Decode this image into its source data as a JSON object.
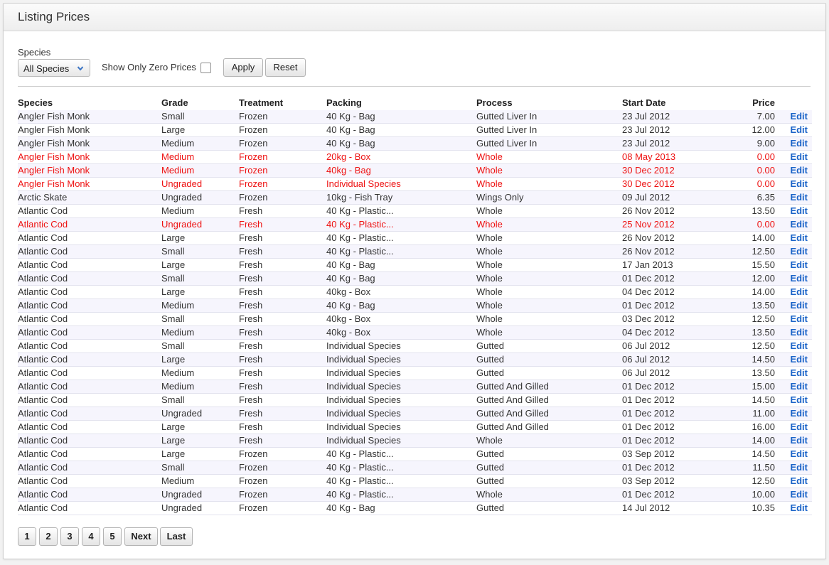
{
  "title": "Listing Prices",
  "filters": {
    "species_label": "Species",
    "species_selected": "All Species",
    "zero_label": "Show Only Zero Prices",
    "apply_label": "Apply",
    "reset_label": "Reset"
  },
  "table": {
    "headers": {
      "species": "Species",
      "grade": "Grade",
      "treatment": "Treatment",
      "packing": "Packing",
      "process": "Process",
      "start_date": "Start Date",
      "price": "Price"
    },
    "edit_label": "Edit",
    "rows": [
      {
        "species": "Angler Fish Monk",
        "grade": "Small",
        "treatment": "Frozen",
        "packing": "40 Kg - Bag",
        "process": "Gutted Liver In",
        "start_date": "23 Jul 2012",
        "price": "7.00",
        "zero": false
      },
      {
        "species": "Angler Fish Monk",
        "grade": "Large",
        "treatment": "Frozen",
        "packing": "40 Kg - Bag",
        "process": "Gutted Liver In",
        "start_date": "23 Jul 2012",
        "price": "12.00",
        "zero": false
      },
      {
        "species": "Angler Fish Monk",
        "grade": "Medium",
        "treatment": "Frozen",
        "packing": "40 Kg - Bag",
        "process": "Gutted Liver In",
        "start_date": "23 Jul 2012",
        "price": "9.00",
        "zero": false
      },
      {
        "species": "Angler Fish Monk",
        "grade": "Medium",
        "treatment": "Frozen",
        "packing": "20kg - Box",
        "process": "Whole",
        "start_date": "08 May 2013",
        "price": "0.00",
        "zero": true
      },
      {
        "species": "Angler Fish Monk",
        "grade": "Medium",
        "treatment": "Frozen",
        "packing": "40kg - Bag",
        "process": "Whole",
        "start_date": "30 Dec 2012",
        "price": "0.00",
        "zero": true
      },
      {
        "species": "Angler Fish Monk",
        "grade": "Ungraded",
        "treatment": "Frozen",
        "packing": "Individual Species",
        "process": "Whole",
        "start_date": "30 Dec 2012",
        "price": "0.00",
        "zero": true
      },
      {
        "species": "Arctic Skate",
        "grade": "Ungraded",
        "treatment": "Frozen",
        "packing": "10kg - Fish Tray",
        "process": "Wings Only",
        "start_date": "09 Jul 2012",
        "price": "6.35",
        "zero": false
      },
      {
        "species": "Atlantic Cod",
        "grade": "Medium",
        "treatment": "Fresh",
        "packing": "40 Kg - Plastic...",
        "process": "Whole",
        "start_date": "26 Nov 2012",
        "price": "13.50",
        "zero": false
      },
      {
        "species": "Atlantic Cod",
        "grade": "Ungraded",
        "treatment": "Fresh",
        "packing": "40 Kg - Plastic...",
        "process": "Whole",
        "start_date": "25 Nov 2012",
        "price": "0.00",
        "zero": true
      },
      {
        "species": "Atlantic Cod",
        "grade": "Large",
        "treatment": "Fresh",
        "packing": "40 Kg - Plastic...",
        "process": "Whole",
        "start_date": "26 Nov 2012",
        "price": "14.00",
        "zero": false
      },
      {
        "species": "Atlantic Cod",
        "grade": "Small",
        "treatment": "Fresh",
        "packing": "40 Kg - Plastic...",
        "process": "Whole",
        "start_date": "26 Nov 2012",
        "price": "12.50",
        "zero": false
      },
      {
        "species": "Atlantic Cod",
        "grade": "Large",
        "treatment": "Fresh",
        "packing": "40 Kg - Bag",
        "process": "Whole",
        "start_date": "17 Jan 2013",
        "price": "15.50",
        "zero": false
      },
      {
        "species": "Atlantic Cod",
        "grade": "Small",
        "treatment": "Fresh",
        "packing": "40 Kg - Bag",
        "process": "Whole",
        "start_date": "01 Dec 2012",
        "price": "12.00",
        "zero": false
      },
      {
        "species": "Atlantic Cod",
        "grade": "Large",
        "treatment": "Fresh",
        "packing": "40kg - Box",
        "process": "Whole",
        "start_date": "04 Dec 2012",
        "price": "14.00",
        "zero": false
      },
      {
        "species": "Atlantic Cod",
        "grade": "Medium",
        "treatment": "Fresh",
        "packing": "40 Kg - Bag",
        "process": "Whole",
        "start_date": "01 Dec 2012",
        "price": "13.50",
        "zero": false
      },
      {
        "species": "Atlantic Cod",
        "grade": "Small",
        "treatment": "Fresh",
        "packing": "40kg - Box",
        "process": "Whole",
        "start_date": "03 Dec 2012",
        "price": "12.50",
        "zero": false
      },
      {
        "species": "Atlantic Cod",
        "grade": "Medium",
        "treatment": "Fresh",
        "packing": "40kg - Box",
        "process": "Whole",
        "start_date": "04 Dec 2012",
        "price": "13.50",
        "zero": false
      },
      {
        "species": "Atlantic Cod",
        "grade": "Small",
        "treatment": "Fresh",
        "packing": "Individual Species",
        "process": "Gutted",
        "start_date": "06 Jul 2012",
        "price": "12.50",
        "zero": false
      },
      {
        "species": "Atlantic Cod",
        "grade": "Large",
        "treatment": "Fresh",
        "packing": "Individual Species",
        "process": "Gutted",
        "start_date": "06 Jul 2012",
        "price": "14.50",
        "zero": false
      },
      {
        "species": "Atlantic Cod",
        "grade": "Medium",
        "treatment": "Fresh",
        "packing": "Individual Species",
        "process": "Gutted",
        "start_date": "06 Jul 2012",
        "price": "13.50",
        "zero": false
      },
      {
        "species": "Atlantic Cod",
        "grade": "Medium",
        "treatment": "Fresh",
        "packing": "Individual Species",
        "process": "Gutted And Gilled",
        "start_date": "01 Dec 2012",
        "price": "15.00",
        "zero": false
      },
      {
        "species": "Atlantic Cod",
        "grade": "Small",
        "treatment": "Fresh",
        "packing": "Individual Species",
        "process": "Gutted And Gilled",
        "start_date": "01 Dec 2012",
        "price": "14.50",
        "zero": false
      },
      {
        "species": "Atlantic Cod",
        "grade": "Ungraded",
        "treatment": "Fresh",
        "packing": "Individual Species",
        "process": "Gutted And Gilled",
        "start_date": "01 Dec 2012",
        "price": "11.00",
        "zero": false
      },
      {
        "species": "Atlantic Cod",
        "grade": "Large",
        "treatment": "Fresh",
        "packing": "Individual Species",
        "process": "Gutted And Gilled",
        "start_date": "01 Dec 2012",
        "price": "16.00",
        "zero": false
      },
      {
        "species": "Atlantic Cod",
        "grade": "Large",
        "treatment": "Fresh",
        "packing": "Individual Species",
        "process": "Whole",
        "start_date": "01 Dec 2012",
        "price": "14.00",
        "zero": false
      },
      {
        "species": "Atlantic Cod",
        "grade": "Large",
        "treatment": "Frozen",
        "packing": "40 Kg - Plastic...",
        "process": "Gutted",
        "start_date": "03 Sep 2012",
        "price": "14.50",
        "zero": false
      },
      {
        "species": "Atlantic Cod",
        "grade": "Small",
        "treatment": "Frozen",
        "packing": "40 Kg - Plastic...",
        "process": "Gutted",
        "start_date": "01 Dec 2012",
        "price": "11.50",
        "zero": false
      },
      {
        "species": "Atlantic Cod",
        "grade": "Medium",
        "treatment": "Frozen",
        "packing": "40 Kg - Plastic...",
        "process": "Gutted",
        "start_date": "03 Sep 2012",
        "price": "12.50",
        "zero": false
      },
      {
        "species": "Atlantic Cod",
        "grade": "Ungraded",
        "treatment": "Frozen",
        "packing": "40 Kg - Plastic...",
        "process": "Whole",
        "start_date": "01 Dec 2012",
        "price": "10.00",
        "zero": false
      },
      {
        "species": "Atlantic Cod",
        "grade": "Ungraded",
        "treatment": "Frozen",
        "packing": "40 Kg - Bag",
        "process": "Gutted",
        "start_date": "14 Jul 2012",
        "price": "10.35",
        "zero": false
      }
    ]
  },
  "pagination": {
    "pages": [
      "1",
      "2",
      "3",
      "4",
      "5"
    ],
    "next_label": "Next",
    "last_label": "Last"
  },
  "colors": {
    "zero_price_row": "#ee1111",
    "edit_link": "#1a63c8"
  },
  "icons": {
    "select_arrow": "chevron-down-icon"
  }
}
